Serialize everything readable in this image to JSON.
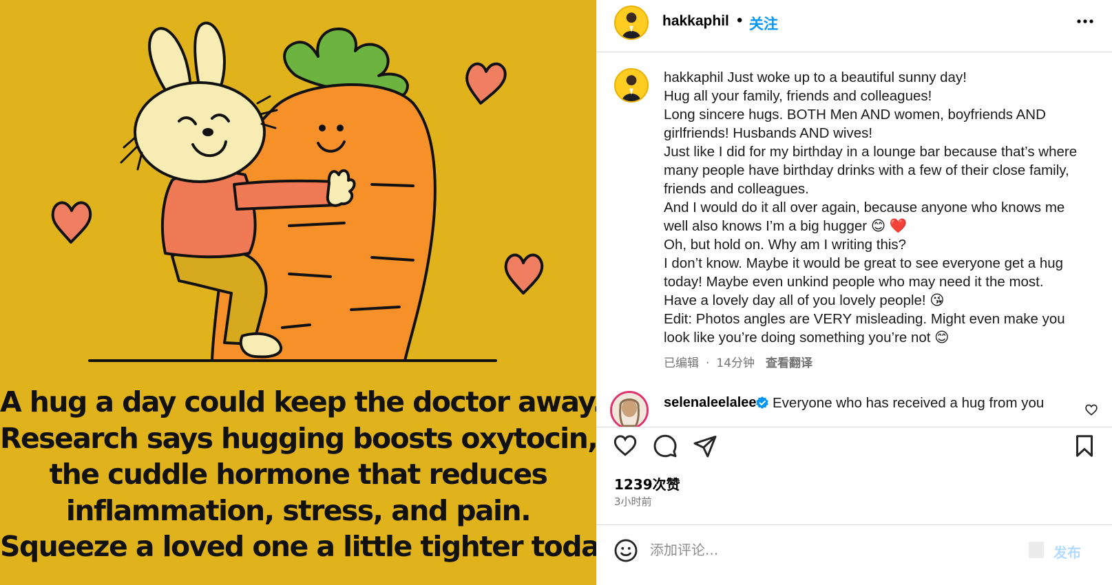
{
  "image": {
    "caption_lines": [
      "A hug a day could keep the doctor away.",
      "Research says hugging boosts oxytocin,",
      "the cuddle hormone that reduces",
      "inflammation, stress, and pain.",
      "Squeeze a loved one a little tighter today"
    ],
    "background_color": "#e0b21c"
  },
  "header": {
    "username": "hakkaphil",
    "separator": "•",
    "follow_label": "关注",
    "more_icon": "more-horizontal-icon"
  },
  "caption": {
    "username": "hakkaphil",
    "text": " Just woke up to a beautiful sunny day!\nHug all your family, friends and colleagues!\nLong sincere hugs. BOTH Men AND women, boyfriends AND girlfriends! Husbands AND wives!\nJust like I did for my birthday in a lounge bar because that’s where many people have birthday drinks with a few of their close family, friends and colleagues.\nAnd I would do it all over again, because anyone who knows me well also knows I’m a big hugger 😊 ❤️\nOh, but hold on. Why am I writing this?\nI don’t know. Maybe it would be great to see everyone get a hug today! Maybe even unkind people who may need it the most.\nHave a lovely day all of you lovely people! 😘\nEdit: Photos angles are VERY misleading. Might even make you look like you’re doing something you’re not 😊",
    "edited_label": "已编辑",
    "separator": "·",
    "time": "14分钟",
    "translate_label": "查看翻译"
  },
  "comment": {
    "username": "selenaleelalee",
    "text": "Everyone who has received a hug from you"
  },
  "actions": {
    "like_icon": "heart-icon",
    "comment_icon": "comment-icon",
    "share_icon": "send-icon",
    "save_icon": "bookmark-icon"
  },
  "stats": {
    "likes": "1239次赞",
    "posted": "3小时前"
  },
  "comment_box": {
    "placeholder": "添加评论...",
    "post_label": "发布"
  },
  "colors": {
    "accent": "#0095f6",
    "post_disabled": "#b3dbff",
    "muted": "#737373"
  }
}
